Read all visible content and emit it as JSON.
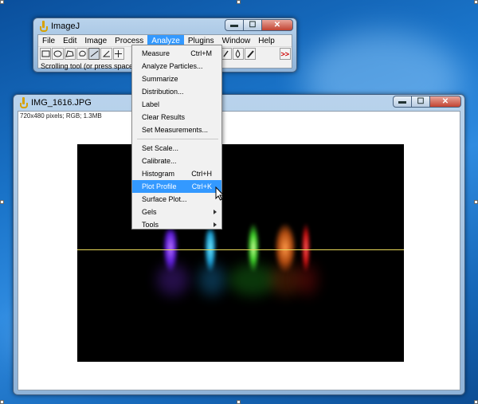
{
  "imagej_window": {
    "title": "ImageJ",
    "menus": [
      {
        "label": "File"
      },
      {
        "label": "Edit"
      },
      {
        "label": "Image"
      },
      {
        "label": "Process"
      },
      {
        "label": "Analyze",
        "active": true
      },
      {
        "label": "Plugins"
      },
      {
        "label": "Window"
      },
      {
        "label": "Help"
      }
    ],
    "tools": [
      "rectangle-tool-icon",
      "oval-tool-icon",
      "polygon-tool-icon",
      "freehand-tool-icon",
      "straight-line-tool-icon",
      "angle-tool-icon",
      "point-tool-icon"
    ],
    "right_tools": [
      "color-picker-icon",
      "dropper-icon",
      "more-tools-icon"
    ],
    "more_tools_label": ">>",
    "status": "Scrolling tool (or press space bar ar"
  },
  "image_window": {
    "title": "IMG_1616.JPG",
    "info": "720x480 pixels; RGB; 1.3MB"
  },
  "analyze_menu": {
    "items": [
      {
        "label": "Measure",
        "shortcut": "Ctrl+M"
      },
      {
        "label": "Analyze Particles..."
      },
      {
        "label": "Summarize"
      },
      {
        "label": "Distribution..."
      },
      {
        "label": "Label"
      },
      {
        "label": "Clear Results"
      },
      {
        "label": "Set Measurements..."
      },
      {
        "separator": true
      },
      {
        "label": "Set Scale..."
      },
      {
        "label": "Calibrate..."
      },
      {
        "label": "Histogram",
        "shortcut": "Ctrl+H"
      },
      {
        "label": "Plot Profile",
        "shortcut": "Ctrl+K",
        "highlighted": true
      },
      {
        "label": "Surface Plot..."
      },
      {
        "label": "Gels",
        "submenu": true
      },
      {
        "label": "Tools",
        "submenu": true
      }
    ]
  },
  "colors": {
    "menu_highlight": "#3399ff",
    "profile_line": "#e9d95a",
    "desktop": "#1a74c9"
  }
}
